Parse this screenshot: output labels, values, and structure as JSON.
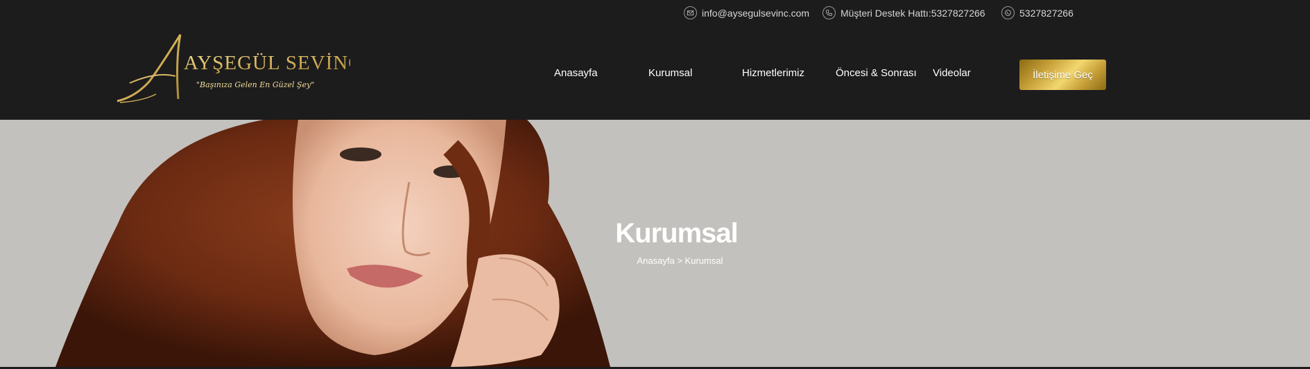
{
  "topbar": {
    "email": "info@aysegulsevinc.com",
    "support_line": "Müşteri Destek Hattı:5327827266",
    "whatsapp": "5327827266"
  },
  "logo": {
    "name": "AYŞEGÜL SEVİNÇ",
    "tagline": "\"Başınıza Gelen En Güzel Şey\""
  },
  "nav": {
    "items": [
      {
        "label": "Anasayfa"
      },
      {
        "label": "Kurumsal"
      },
      {
        "label": "Hizmetlerimiz"
      },
      {
        "label": "Öncesi & Sonrası"
      },
      {
        "label": "Videolar"
      }
    ],
    "cta_label": "İletişime Geç"
  },
  "hero": {
    "title": "Kurumsal",
    "breadcrumb_home": "Anasayfa",
    "breadcrumb_separator": ">",
    "breadcrumb_current": "Kurumsal"
  },
  "colors": {
    "header_bg": "#1c1c1c",
    "hero_bg": "#c3c1bd",
    "gold": "#c9a13a"
  }
}
